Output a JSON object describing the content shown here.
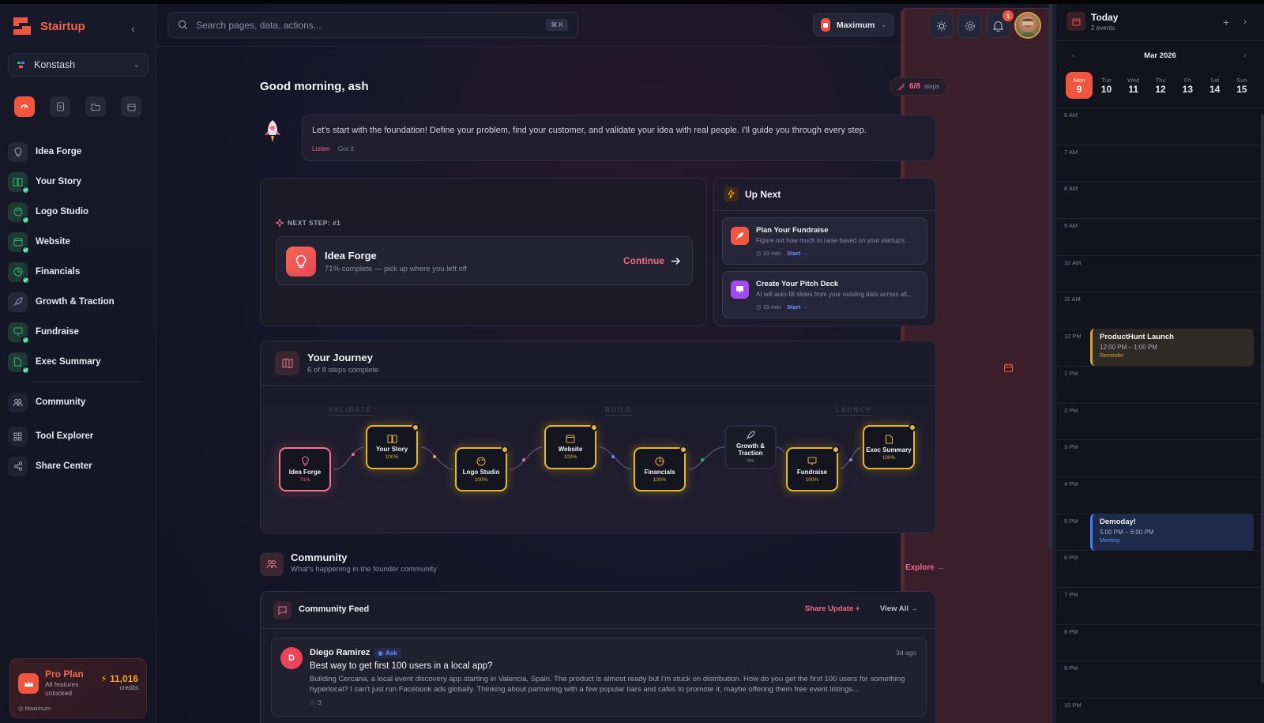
{
  "brand": {
    "name": "Stairtup",
    "accent": "#f0553f"
  },
  "org": {
    "name": "Konstash"
  },
  "quick_actions": [
    "dashboard-icon",
    "document-icon",
    "folder-icon",
    "calendar-icon"
  ],
  "nav": {
    "items": [
      {
        "label": "Idea Forge",
        "icon": "lightbulb-icon",
        "done": false
      },
      {
        "label": "Your Story",
        "icon": "book-icon",
        "done": true
      },
      {
        "label": "Logo Studio",
        "icon": "palette-icon",
        "done": true
      },
      {
        "label": "Website",
        "icon": "browser-icon",
        "done": true
      },
      {
        "label": "Financials",
        "icon": "chart-icon",
        "done": true
      },
      {
        "label": "Growth & Traction",
        "icon": "rocket-icon",
        "done": false
      },
      {
        "label": "Fundraise",
        "icon": "presentation-icon",
        "done": true
      },
      {
        "label": "Exec Summary",
        "icon": "file-icon",
        "done": true
      }
    ],
    "secondary": [
      {
        "label": "Community",
        "icon": "users-icon"
      },
      {
        "label": "Tool Explorer",
        "icon": "grid-icon"
      },
      {
        "label": "Share Center",
        "icon": "share-icon"
      }
    ]
  },
  "plan": {
    "title": "Pro Plan",
    "subtitle": "All features unlocked",
    "credits": "11,016",
    "credits_label": "credits",
    "tier": "Maximum"
  },
  "topbar": {
    "search_placeholder": "Search pages, data, actions...",
    "shortcut": "⌘ K",
    "tier": "Maximum",
    "notifications": "1"
  },
  "greeting": "Good morning, ash",
  "progress": {
    "done": "6/8",
    "label": "steps"
  },
  "coach": {
    "message": "Let's start with the foundation! Define your problem, find your customer, and validate your idea with real people. I'll guide you through every step.",
    "listen": "Listen",
    "dismiss": "Got it"
  },
  "next_step": {
    "label": "NEXT STEP: #1",
    "title": "Idea Forge",
    "subtitle": "71% complete — pick up where you left off",
    "cta": "Continue"
  },
  "up_next": {
    "title": "Up Next",
    "items": [
      {
        "title": "Plan Your Fundraise",
        "desc": "Figure out how much to raise based on your startup's...",
        "time": "10 min",
        "cta": "Start →",
        "color": "#f0553f"
      },
      {
        "title": "Create Your Pitch Deck",
        "desc": "AI will auto-fill slides from your existing data across all...",
        "time": "15 min",
        "cta": "Start →",
        "color": "#a04cf0"
      }
    ]
  },
  "journey": {
    "title": "Your Journey",
    "subtitle": "6 of 8 steps complete",
    "phases": [
      "VALIDATE",
      "BUILD",
      "LAUNCH"
    ],
    "steps": [
      {
        "label": "Idea Forge",
        "progress": "71%",
        "state": "active"
      },
      {
        "label": "Your Story",
        "progress": "100%",
        "state": "done"
      },
      {
        "label": "Logo Studio",
        "progress": "100%",
        "state": "done"
      },
      {
        "label": "Website",
        "progress": "100%",
        "state": "done"
      },
      {
        "label": "Financials",
        "progress": "100%",
        "state": "done"
      },
      {
        "label": "Growth & Traction",
        "progress": "0%",
        "state": "todo"
      },
      {
        "label": "Fundraise",
        "progress": "100%",
        "state": "done"
      },
      {
        "label": "Exec Summary",
        "progress": "100%",
        "state": "done"
      }
    ]
  },
  "community": {
    "title": "Community",
    "subtitle": "What's happening in the founder community",
    "explore": "Explore →"
  },
  "feed": {
    "title": "Community Feed",
    "share": "Share Update +",
    "view_all": "View All →",
    "post": {
      "initial": "D",
      "author": "Diego Ramirez",
      "tag": "Ask",
      "time": "3d ago",
      "question": "Best way to get first 100 users in a local app?",
      "body": "Building Cercana, a local event discovery app starting in Valencia, Spain. The product is almost ready but I'm stuck on distribution. How do you get the first 100 users for something hyperlocal? I can't just run Facebook ads globally. Thinking about partnering with a few popular bars and cafes to promote it, maybe offering them free event listings...",
      "likes": "3"
    }
  },
  "calendar": {
    "title": "Today",
    "subtitle": "2 events",
    "month": "Mar 2026",
    "days": [
      {
        "name": "Mon",
        "date": "9",
        "selected": true
      },
      {
        "name": "Tue",
        "date": "10"
      },
      {
        "name": "Wed",
        "date": "11"
      },
      {
        "name": "Thu",
        "date": "12"
      },
      {
        "name": "Fri",
        "date": "13"
      },
      {
        "name": "Sat",
        "date": "14"
      },
      {
        "name": "Sun",
        "date": "15"
      }
    ],
    "hours": [
      "6 AM",
      "7 AM",
      "8 AM",
      "9 AM",
      "10 AM",
      "11 AM",
      "12 PM",
      "1 PM",
      "2 PM",
      "3 PM",
      "4 PM",
      "5 PM",
      "6 PM",
      "7 PM",
      "8 PM",
      "9 PM",
      "10 PM"
    ],
    "events": [
      {
        "title": "ProductHunt Launch",
        "time": "12:00 PM – 1:00 PM",
        "tag": "Reminder",
        "color": "#e0a030"
      },
      {
        "title": "Demoday!",
        "time": "5:00 PM – 6:00 PM",
        "tag": "Meeting",
        "color": "#4c7cf0"
      }
    ]
  }
}
